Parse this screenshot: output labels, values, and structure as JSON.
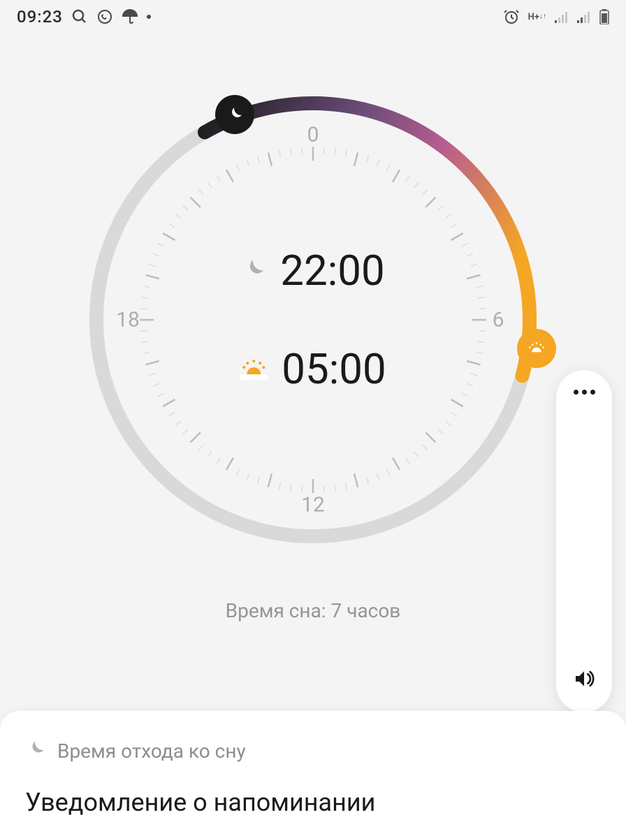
{
  "status": {
    "time": "09:23",
    "network_label": "H+"
  },
  "dial": {
    "top": "0",
    "right": "6",
    "bottom": "12",
    "left": "18"
  },
  "sleep": {
    "bedtime": "22:00",
    "wake": "05:00",
    "duration": "Время сна: 7 часов"
  },
  "card": {
    "header": "Время отхода ко сну",
    "title": "Уведомление о напоминании"
  }
}
